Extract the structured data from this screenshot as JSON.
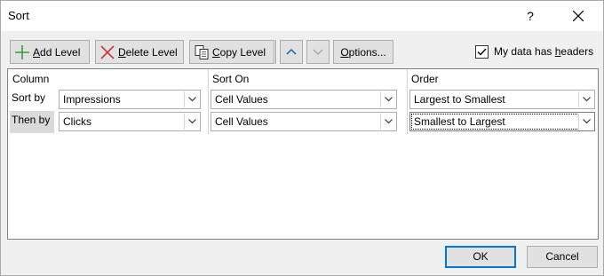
{
  "window": {
    "title": "Sort",
    "help": "?"
  },
  "toolbar": {
    "add_level": "Add Level",
    "delete_level": "Delete Level",
    "copy_level": "Copy Level",
    "options": "Options...",
    "move_up_enabled": true,
    "move_down_enabled": false
  },
  "headers_checkbox": {
    "label": "My data has headers",
    "checked": true
  },
  "columns": {
    "column": "Column",
    "sort_on": "Sort On",
    "order": "Order"
  },
  "levels": [
    {
      "label": "Sort by",
      "column": "Impressions",
      "sort_on": "Cell Values",
      "order": "Largest to Smallest"
    },
    {
      "label": "Then by",
      "column": "Clicks",
      "sort_on": "Cell Values",
      "order": "Smallest to Largest"
    }
  ],
  "footer": {
    "ok": "OK",
    "cancel": "Cancel"
  },
  "colors": {
    "accent": "#0078d7",
    "add_icon": "#3c9a3c",
    "delete_icon": "#d13438"
  }
}
